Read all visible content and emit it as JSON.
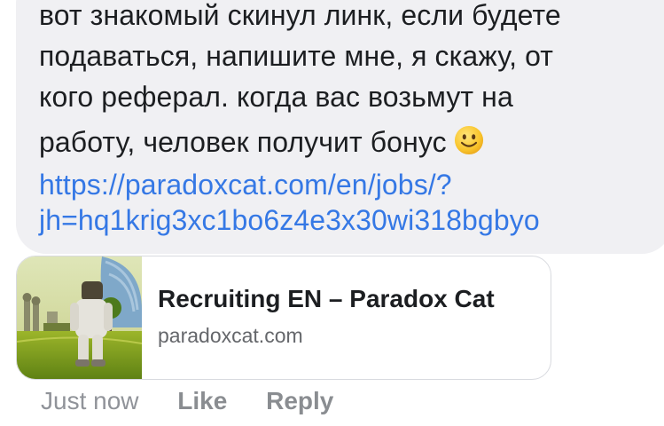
{
  "message": {
    "lines": [
      "вот знакомый скинул линк, если будете",
      "подаваться, напишите мне, я скажу, от",
      "кого реферал. когда вас возьмут на",
      "работу, человек получит бонус"
    ],
    "emoji": "slightly-smiling-face-icon",
    "link_lines": [
      "https://paradoxcat.com/en/jobs/?",
      "jh=hq1krig3xc1bo6z4e3x30wi318bgbyo"
    ],
    "link_color": "#3578e5",
    "bubble_color": "#f0f0f3"
  },
  "link_preview": {
    "title": "Recruiting EN – Paradox Cat",
    "domain": "paradoxcat.com",
    "thumbnail": "astronaut-in-park-image"
  },
  "actions": {
    "timestamp": "Just now",
    "like_label": "Like",
    "reply_label": "Reply"
  }
}
